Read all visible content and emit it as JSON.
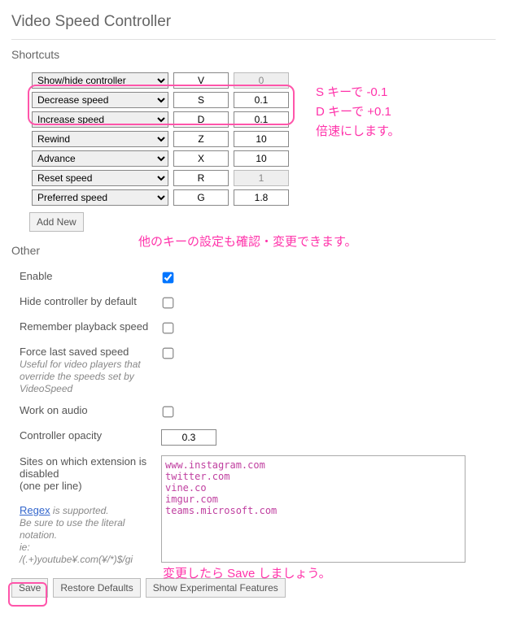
{
  "title": "Video Speed Controller",
  "sections": {
    "shortcuts": "Shortcuts",
    "other": "Other"
  },
  "shortcuts": [
    {
      "action": "Show/hide controller",
      "key": "V",
      "value": "0",
      "value_readonly": true
    },
    {
      "action": "Decrease speed",
      "key": "S",
      "value": "0.1",
      "value_readonly": false
    },
    {
      "action": "Increase speed",
      "key": "D",
      "value": "0.1",
      "value_readonly": false
    },
    {
      "action": "Rewind",
      "key": "Z",
      "value": "10",
      "value_readonly": false
    },
    {
      "action": "Advance",
      "key": "X",
      "value": "10",
      "value_readonly": false
    },
    {
      "action": "Reset speed",
      "key": "R",
      "value": "1",
      "value_readonly": true
    },
    {
      "action": "Preferred speed",
      "key": "G",
      "value": "1.8",
      "value_readonly": false
    }
  ],
  "add_new": "Add New",
  "other": {
    "enable": {
      "label": "Enable",
      "checked": true
    },
    "hide_default": {
      "label": "Hide controller by default",
      "checked": false
    },
    "remember": {
      "label": "Remember playback speed",
      "checked": false
    },
    "force": {
      "label": "Force last saved speed",
      "hint": "Useful for video players that override the speeds set by VideoSpeed",
      "checked": false
    },
    "audio": {
      "label": "Work on audio",
      "checked": false
    },
    "opacity": {
      "label": "Controller opacity",
      "value": "0.3"
    },
    "disabled_sites": {
      "label": "Sites on which extension is disabled",
      "sublabel": "(one per line)",
      "regex_link": "Regex",
      "regex_text": " is supported.",
      "notation": "Be sure to use the literal notation.",
      "ie": "ie:",
      "example": "/(.+)youtube¥.com(¥/*)$/gi",
      "value": "www.instagram.com\ntwitter.com\nvine.co\nimgur.com\nteams.microsoft.com"
    }
  },
  "footer": {
    "save": "Save",
    "restore": "Restore Defaults",
    "experimental": "Show Experimental Features"
  },
  "annotations": {
    "a1": "S キーで -0.1\nD キーで +0.1\n倍速にします。",
    "a2": "他のキーの設定も確認・変更できます。",
    "a3": "変更したら Save しましょう。"
  }
}
